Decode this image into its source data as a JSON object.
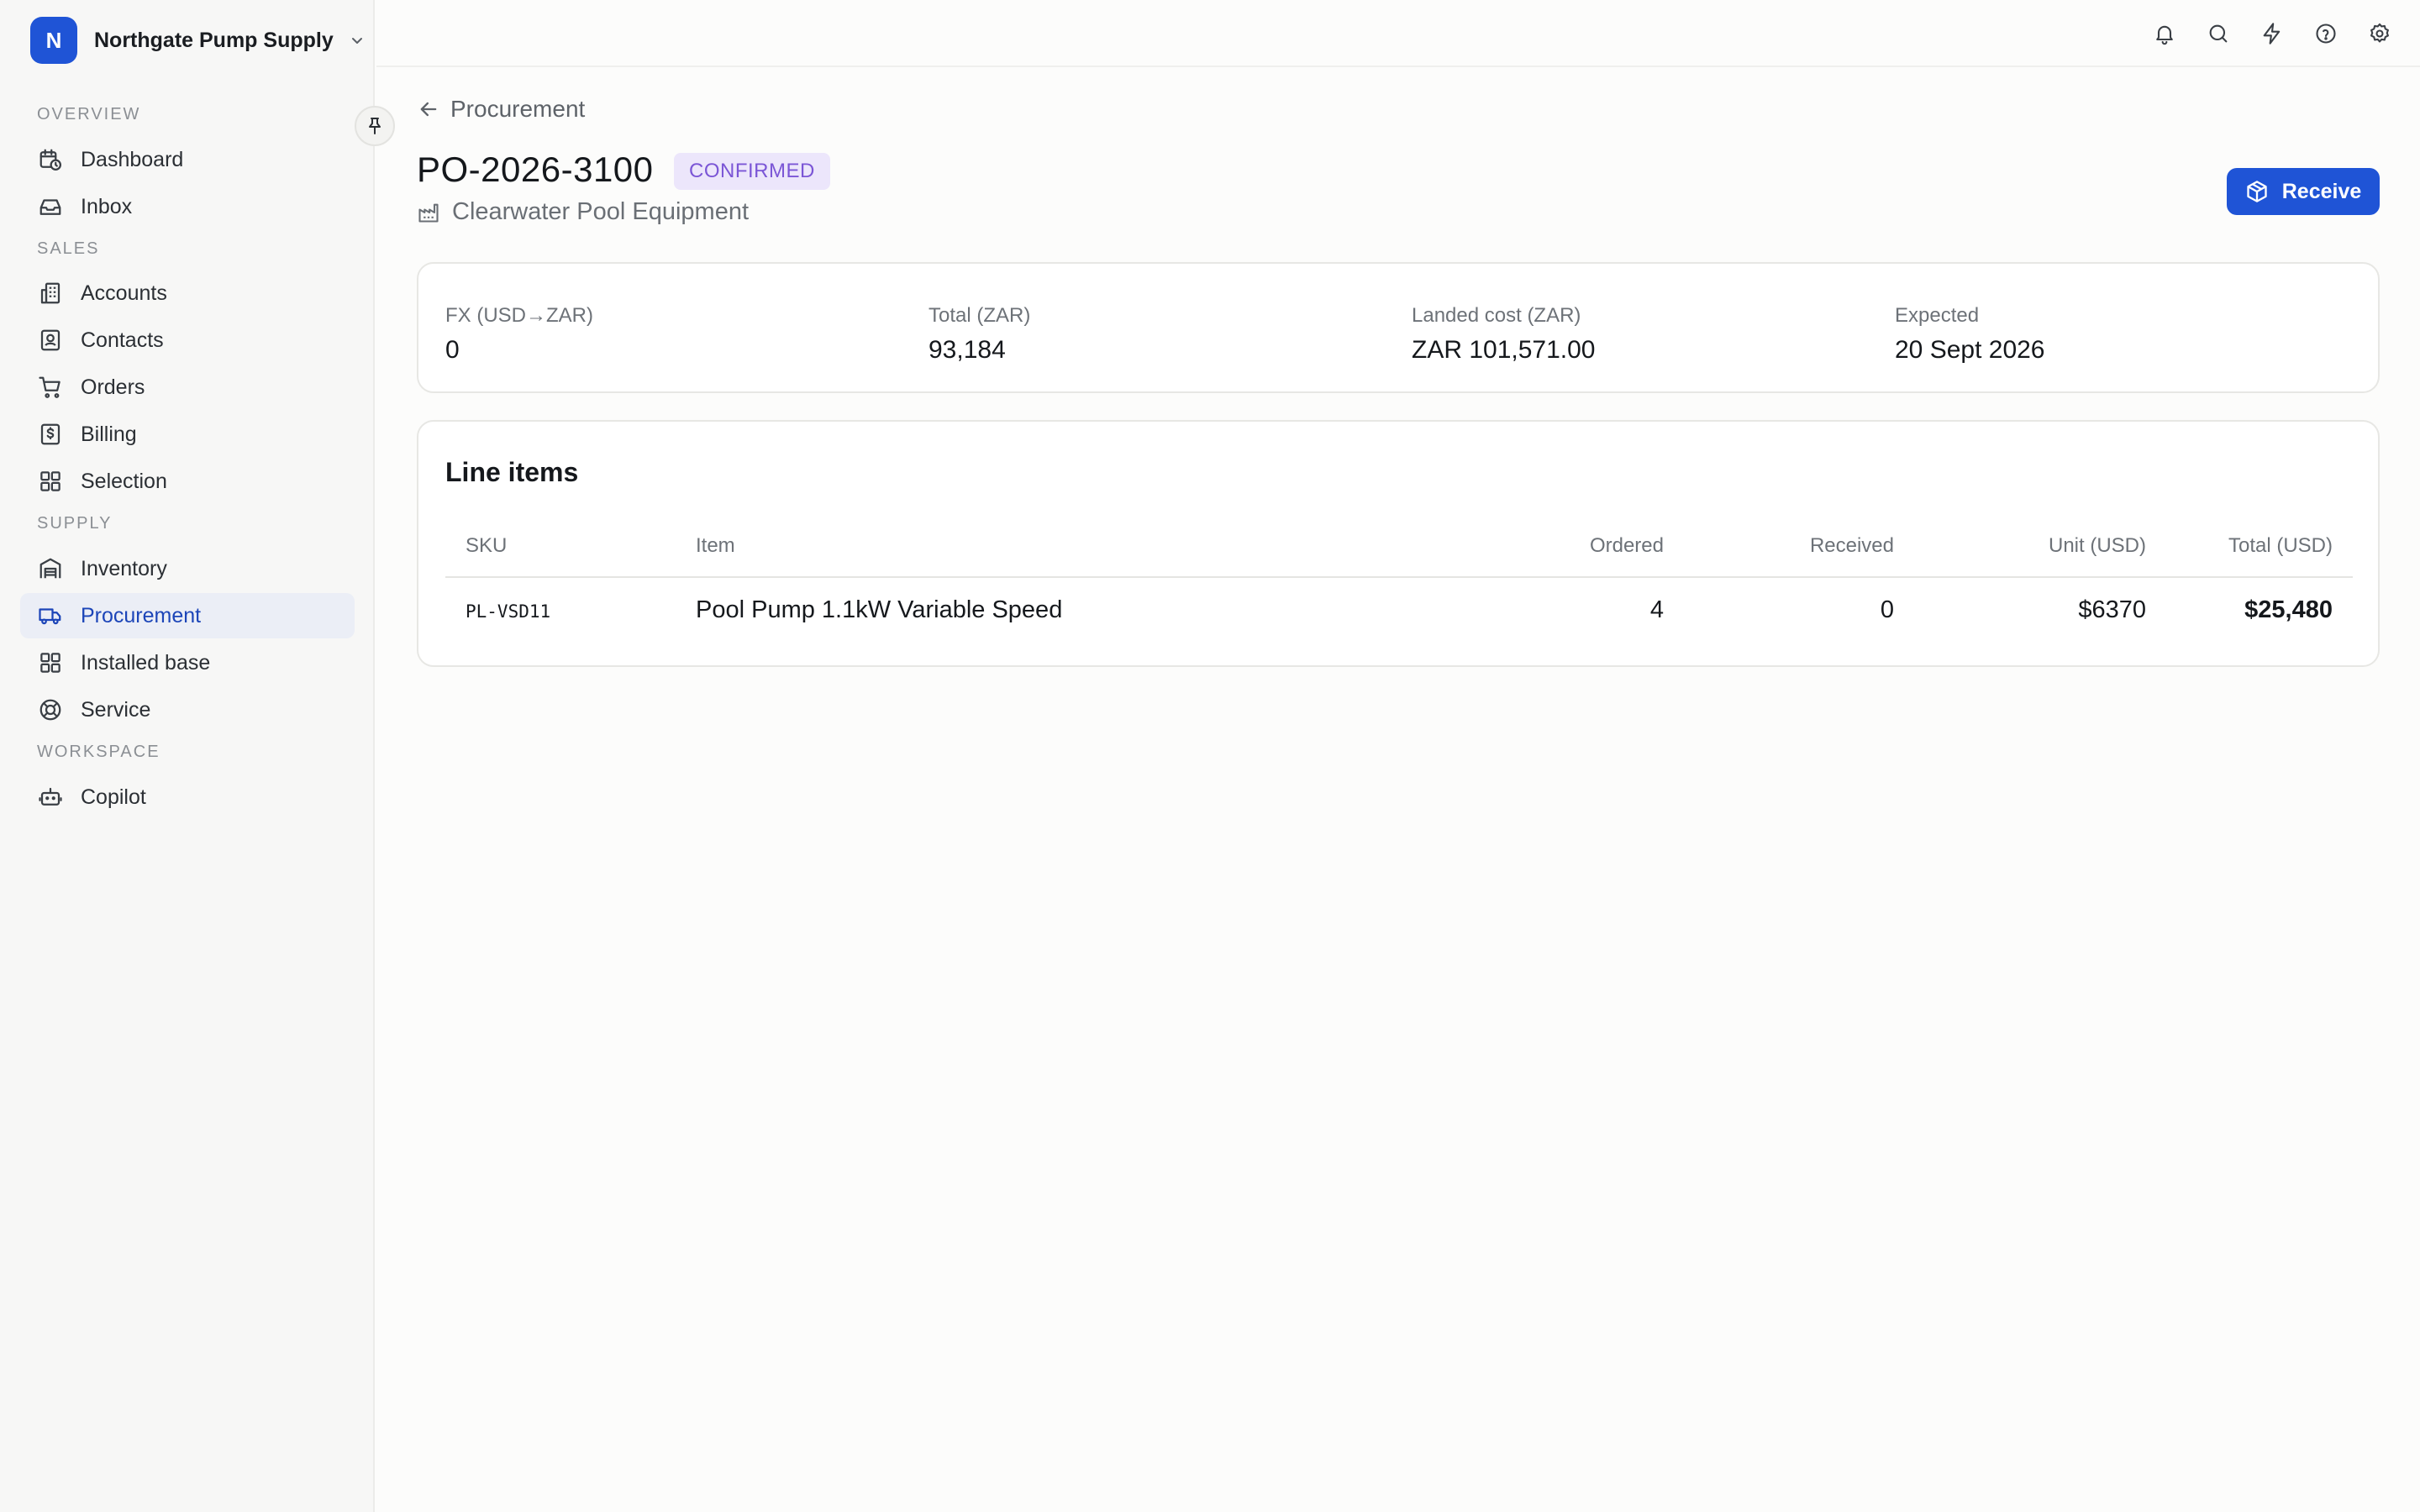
{
  "org": {
    "initial": "N",
    "name": "Northgate Pump Supply"
  },
  "nav": {
    "sections": {
      "overview": "OVERVIEW",
      "sales": "SALES",
      "supply": "SUPPLY",
      "workspace": "WORKSPACE"
    },
    "items": {
      "dashboard": "Dashboard",
      "inbox": "Inbox",
      "accounts": "Accounts",
      "contacts": "Contacts",
      "orders": "Orders",
      "billing": "Billing",
      "selection": "Selection",
      "inventory": "Inventory",
      "procurement": "Procurement",
      "installed_base": "Installed base",
      "service": "Service",
      "copilot": "Copilot"
    },
    "active": "procurement"
  },
  "topbar": {
    "icons": [
      "bell-icon",
      "search-icon",
      "bolt-icon",
      "help-icon",
      "settings-icon"
    ]
  },
  "page": {
    "back_label": "Procurement",
    "po_number": "PO-2026-3100",
    "status": "CONFIRMED",
    "supplier": "Clearwater Pool Equipment",
    "receive_label": "Receive"
  },
  "stats": [
    {
      "label": "FX (USD→ZAR)",
      "value": "0"
    },
    {
      "label": "Total (ZAR)",
      "value": "93,184"
    },
    {
      "label": "Landed cost (ZAR)",
      "value": "ZAR 101,571.00"
    },
    {
      "label": "Expected",
      "value": "20 Sept 2026"
    }
  ],
  "line_items": {
    "title": "Line items",
    "columns": {
      "sku": "SKU",
      "item": "Item",
      "ordered": "Ordered",
      "received": "Received",
      "unit": "Unit (USD)",
      "total": "Total (USD)"
    },
    "rows": [
      {
        "sku": "PL-VSD11",
        "item": "Pool Pump 1.1kW Variable Speed",
        "ordered": "4",
        "received": "0",
        "unit": "$6370",
        "total": "$25,480"
      }
    ]
  },
  "colors": {
    "accent": "#1f54d6",
    "badge_bg": "#ece6fb",
    "badge_text": "#7b56d6",
    "active_nav_bg": "#ebeef6"
  }
}
